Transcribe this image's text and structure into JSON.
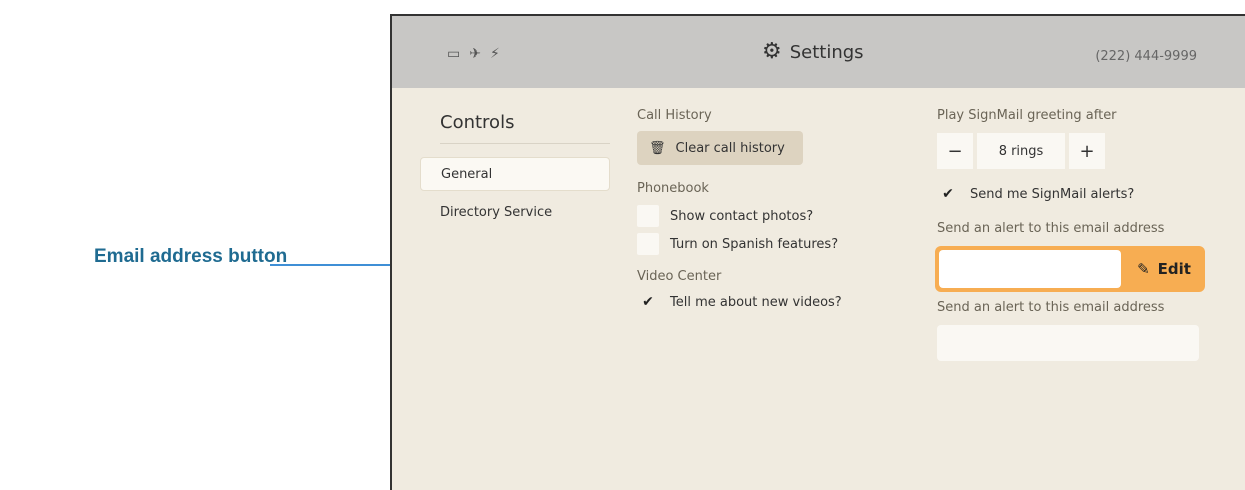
{
  "callout": {
    "label": "Email address button"
  },
  "header": {
    "status_icons": [
      "▭",
      "✈",
      "⚡"
    ],
    "title": "Settings",
    "phone": "(222) 444-9999"
  },
  "sidebar": {
    "heading": "Controls",
    "items": [
      {
        "label": "General"
      },
      {
        "label": "Directory Service"
      }
    ]
  },
  "call_history": {
    "label": "Call History",
    "clear_button": "Clear call history"
  },
  "phonebook": {
    "label": "Phonebook",
    "options": [
      {
        "label": "Show contact photos?",
        "checked": false
      },
      {
        "label": "Turn on Spanish features?",
        "checked": false
      }
    ]
  },
  "video_center": {
    "label": "Video Center",
    "options": [
      {
        "label": "Tell me about new videos?",
        "checked": true
      }
    ]
  },
  "signmail": {
    "greeting_label": "Play SignMail greeting after",
    "minus": "−",
    "rings": "8 rings",
    "plus": "+",
    "alerts_label": "Send me SignMail alerts?",
    "alerts_checked": true,
    "email_label_1": "Send an alert to this email address",
    "email_value_1": "",
    "edit_button": "Edit",
    "email_label_2": "Send an alert to this email address",
    "email_value_2": ""
  },
  "colors": {
    "accent": "#f7ad52",
    "arrow": "#3f8fd6",
    "callout": "#1f6b91"
  }
}
